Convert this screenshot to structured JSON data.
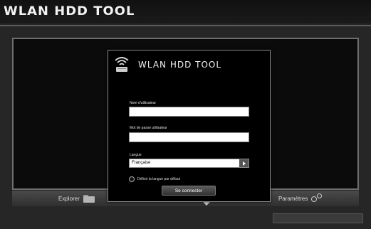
{
  "app": {
    "title": "WLAN HDD TOOL"
  },
  "dialog": {
    "title": "WLAN HDD TOOL",
    "username_label": "Nom d'utilisateur",
    "username_value": "",
    "password_label": "Mot de passe utilisateur",
    "password_value": "",
    "language_label": "Langue",
    "language_selected": "Française",
    "default_language_label": "Définir la langue par défaut",
    "connect_button": "Se connecter"
  },
  "bottom_bar": {
    "explorer_label": "Explorer",
    "settings_label": "Paramètres"
  },
  "icons": {
    "wifi": "wifi-icon",
    "folder": "folder-icon",
    "settings": "gear-icon",
    "dropdown": "chevron-right-icon",
    "expand": "chevron-down-icon"
  }
}
